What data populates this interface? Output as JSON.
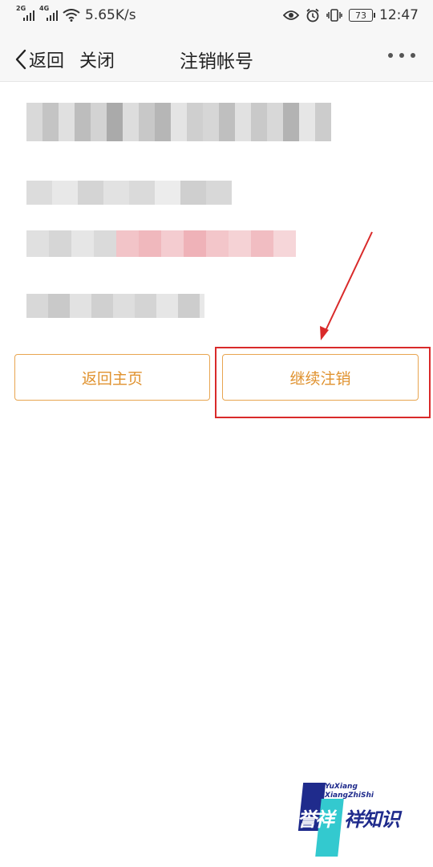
{
  "status_bar": {
    "network1": "2G",
    "network2": "4G",
    "speed": "5.65K/s",
    "battery": "73",
    "time": "12:47",
    "icons": [
      "eye-icon",
      "alarm-icon",
      "vibrate-icon",
      "battery-icon"
    ]
  },
  "nav": {
    "back_label": "返回",
    "close_label": "关闭",
    "title": "注销帐号",
    "more_icon": "more-dots-icon"
  },
  "buttons": {
    "home_label": "返回主页",
    "continue_label": "继续注销"
  },
  "colors": {
    "accent": "#e0922f",
    "button_border": "#e8a550",
    "highlight": "#d92a2a"
  },
  "watermark": {
    "en_line1": "YuXiang",
    "en_line2": "XiangZhiShi",
    "cn_part1": "誉祥",
    "cn_part2": "祥知识"
  }
}
